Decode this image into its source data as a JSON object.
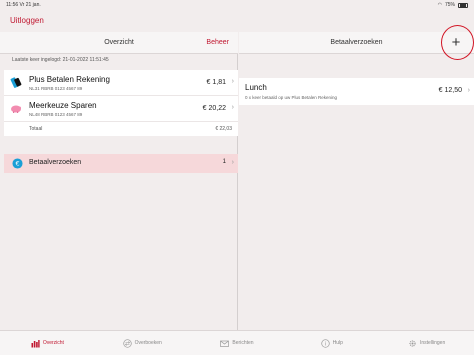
{
  "status_bar": {
    "time_date": "11:56   Vr 21 jan.",
    "battery": "75%"
  },
  "top": {
    "logout_label": "Uitloggen"
  },
  "left_panel": {
    "title": "Overzicht",
    "action_label": "Beheer",
    "last_login": "Laatste keer ingelogd:  21-01-2022 11:51:45",
    "accounts": [
      {
        "name": "Plus Betalen Rekening",
        "iban": "NL31 RBRB 0123 4567 89",
        "amount": "€ 1,81"
      },
      {
        "name": "Meerkeuze Sparen",
        "iban": "NL48 RBRB 0123 4567 89",
        "amount": "€ 20,22"
      }
    ],
    "total_label": "Totaal",
    "total_amount": "€ 22,03",
    "payment_requests": {
      "label": "Betaalverzoeken",
      "count": "1"
    }
  },
  "right_panel": {
    "title": "Betaalverzoeken",
    "add_icon": "plus-icon",
    "request": {
      "title": "Lunch",
      "subtitle": "0 x keer betaald op uw Plus Betalen Rekening",
      "amount": "€ 12,50"
    }
  },
  "tabs": [
    {
      "label": "Overzicht",
      "icon": "chart-icon",
      "active": true
    },
    {
      "label": "Overboeken",
      "icon": "transfer-icon",
      "active": false
    },
    {
      "label": "Berichten",
      "icon": "mail-icon",
      "active": false
    },
    {
      "label": "Hulp",
      "icon": "help-icon",
      "active": false
    },
    {
      "label": "Instellingen",
      "icon": "gear-icon",
      "active": false
    }
  ],
  "colors": {
    "accent": "#c01730",
    "highlight": "#f6d8da",
    "annotation_circle": "#d21525"
  }
}
